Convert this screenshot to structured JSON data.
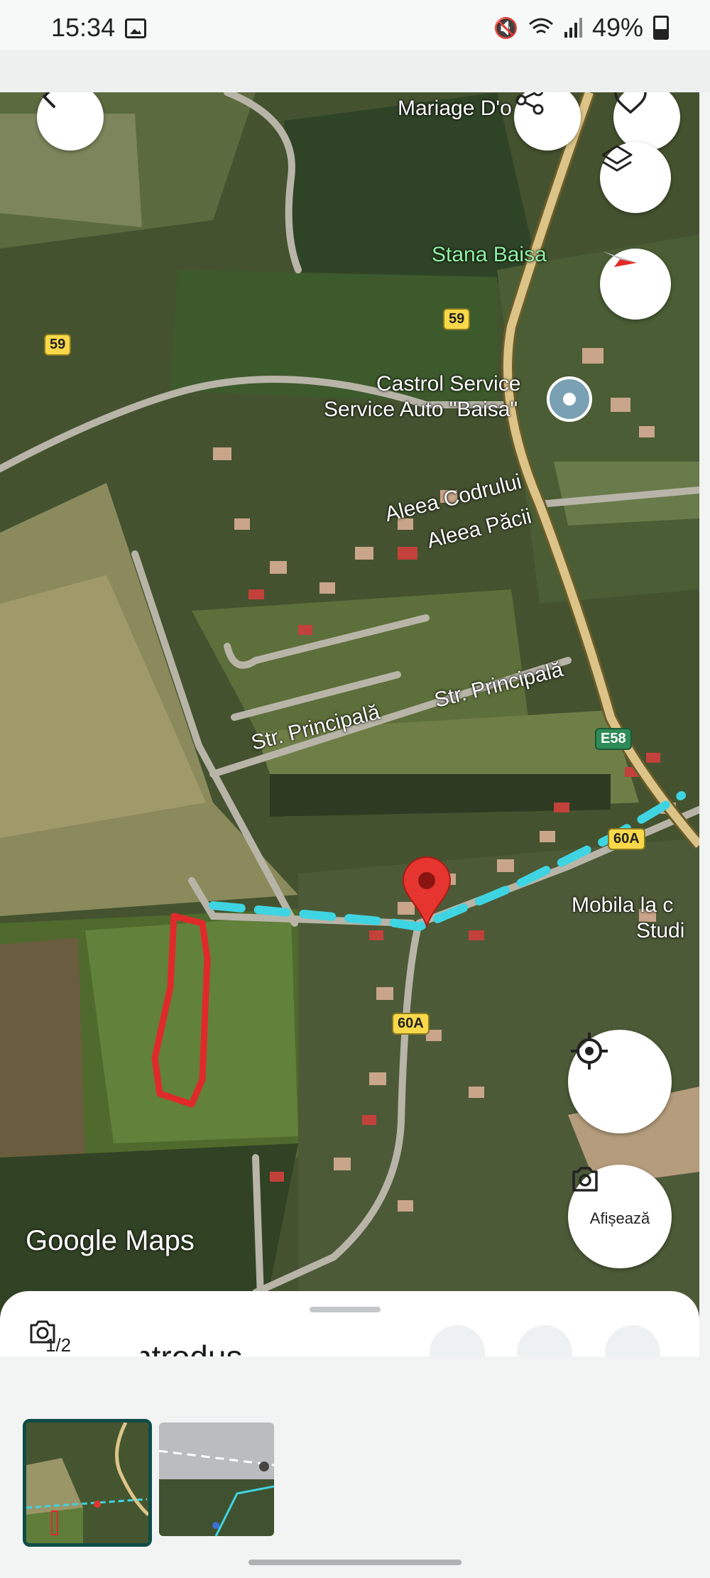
{
  "status_bar": {
    "time": "15:34",
    "battery": "49%"
  },
  "map": {
    "labels": {
      "mariage": "Mariage D'o",
      "stana": "Stana Baisa",
      "castrol1": "Castrol Service",
      "castrol2": "Service Auto \"Baisa\"",
      "aleea_codrului": "Aleea Codrului",
      "aleea_pacii": "Aleea Păcii",
      "str_principala": "Str. Principală",
      "mobila1": "Mobila la c",
      "mobila2": "Studi"
    },
    "route_shields": {
      "r59": "59",
      "e58": "E58",
      "r60a": "60A"
    },
    "watermark": "Google Maps",
    "icons": [
      "back-icon",
      "share-icon",
      "favorite-icon",
      "layers-icon",
      "compass-icon",
      "my-location-icon",
      "lens-icon",
      "place-pin-icon",
      "red-location-pin-icon"
    ]
  },
  "actions": {
    "show_label": "Afișează"
  },
  "sheet": {
    "title": "l... tor introdus",
    "image_counter": "1/2"
  },
  "thumbnails": [
    {
      "name": "map-screenshot"
    },
    {
      "name": "street-photo"
    }
  ]
}
